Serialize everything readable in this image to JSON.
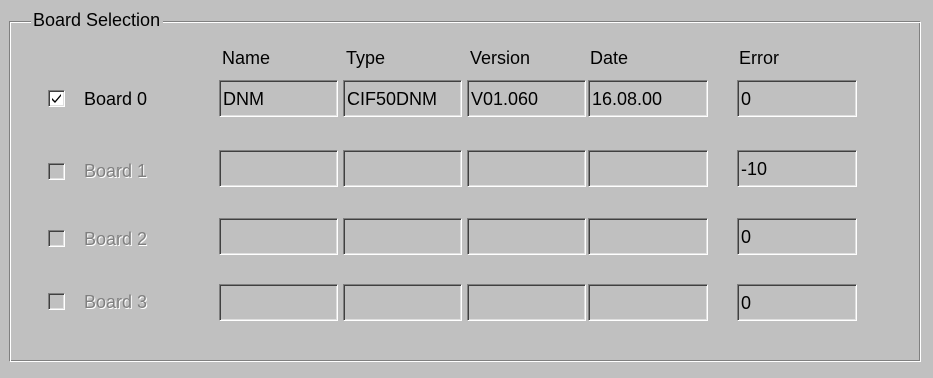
{
  "group": {
    "title": "Board Selection"
  },
  "columns": {
    "name": "Name",
    "type": "Type",
    "version": "Version",
    "date": "Date",
    "error": "Error"
  },
  "boards": [
    {
      "label": "Board 0",
      "checked": true,
      "enabled": true,
      "name": "DNM",
      "type": "CIF50DNM",
      "version": "V01.060",
      "date": "16.08.00",
      "error": "0"
    },
    {
      "label": "Board 1",
      "checked": false,
      "enabled": false,
      "name": "",
      "type": "",
      "version": "",
      "date": "",
      "error": "-10"
    },
    {
      "label": "Board 2",
      "checked": false,
      "enabled": false,
      "name": "",
      "type": "",
      "version": "",
      "date": "",
      "error": "0"
    },
    {
      "label": "Board 3",
      "checked": false,
      "enabled": false,
      "name": "",
      "type": "",
      "version": "",
      "date": "",
      "error": "0"
    }
  ]
}
